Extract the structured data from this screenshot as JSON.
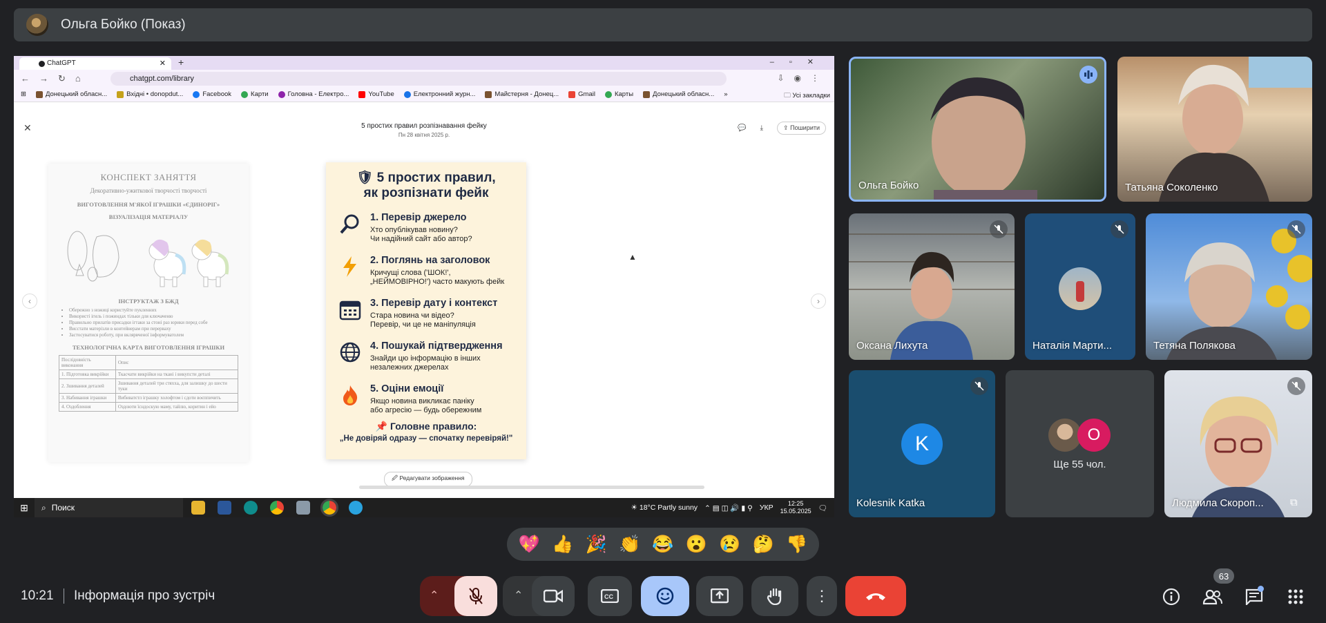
{
  "header": {
    "title": "Ольга Бойко (Показ)"
  },
  "browser": {
    "tab_title": "ChatGPT",
    "new_tab": "+",
    "url": "chatgpt.com/library",
    "bookmarks": [
      "Донецький обласн...",
      "Вхідні • donopdut...",
      "Facebook",
      "Карти",
      "Головна - Електро...",
      "YouTube",
      "Електронний журн...",
      "Майстерня - Донец...",
      "Gmail",
      "Карты",
      "Донецький обласн..."
    ],
    "bookmarks_more": "»",
    "all_bookmarks": "Усі закладки"
  },
  "page": {
    "title": "5 простих правил розпізнавання фейку",
    "date": "Пн 28 квітня 2025 р.",
    "share": "Поширити",
    "edit_image": "Редагувати зображення"
  },
  "left_doc": {
    "title": "КОНСПЕКТ ЗАНЯТТЯ",
    "subtitle": "Декоративно-ужиткової творчості творчості",
    "heading": "ВИГОТОВЛЕННЯ М'ЯКОЇ ІГРАШКИ «ЄДИНОРІГ»",
    "section_visual": "ВІЗУАЛІЗАЦІЯ МАТЕРІАЛУ",
    "section_safety": "ІНСТРУКТАЖ З БЖД",
    "safety_items": [
      "Обережно з ножиці користуйте пукленних",
      "Використі ігиль і пожиндах тільки для ключаченю",
      "Правильно прилатів присадки ігтаки за стоні раз юрики перед собе",
      "Висстати матерізли в контейнерам при перерваху",
      "Застосуватися роботу, при вклярвченої інформуватолем"
    ],
    "section_map": "ТЕХНОЛОГІЧНА КАРТА ВИГОТОВЛЕННЯ ІГРАШКИ",
    "table_headers": [
      "Послідовність виконання",
      "Опис"
    ],
    "table_rows": [
      [
        "1. Підготовка викрійки",
        "Ткасчати викрійки на ткані і викупсти деталі"
      ],
      [
        "2. Зшивання деталей",
        "Зшивання деталей три стяхха, для залишку до шести туки"
      ],
      [
        "3. Набивання іграшки",
        "Вибиватєтл іграшку холофтом і сдоти воєппичить"
      ],
      [
        "4. Оздоблення",
        "Оздоюти їсндоскую маму, тайлю, коритин і ейо"
      ]
    ]
  },
  "card": {
    "title_line1": "5 простих правил,",
    "title_line2": "як розпізнати фейк",
    "rules": [
      {
        "icon": "magnifier-icon",
        "title": "1. Перевір джерело",
        "line1": "Хто опублікував новину?",
        "line2": "Чи надійний сайт або автор?"
      },
      {
        "icon": "lightning-icon",
        "title": "2. Поглянь на заголовок",
        "line1": "Кричущі слова ('ШОК!',",
        "line2": "„НЕЙМОВІРНО!') часто макують фейк"
      },
      {
        "icon": "calendar-icon",
        "title": "3. Перевір дату і контекст",
        "line1": "Стара новина чи відео?",
        "line2": "Перевір, чи це не маніпуляція"
      },
      {
        "icon": "globe-icon",
        "title": "4. Пошукай підтвердження",
        "line1": "Знайди цю інформацію в інших",
        "line2": "незалежних джерелах"
      },
      {
        "icon": "fire-icon",
        "title": "5. Оціни емоції",
        "line1": "Якщо новина викликає паніку",
        "line2": "або агресію — будь обережним"
      }
    ],
    "main_rule": "Головне правило:",
    "main_quote": "„Не довіряй одразу — спочатку перевіряй!\""
  },
  "taskbar": {
    "search": "Поиск",
    "weather": "18°C  Partly sunny",
    "lang": "УКР",
    "time": "12:25",
    "date": "15.05.2025"
  },
  "participants": [
    {
      "name": "Ольга Бойко",
      "state": "speaking"
    },
    {
      "name": "Татьяна Соколенко",
      "state": "unmuted"
    },
    {
      "name": "Оксана Лихута",
      "state": "muted"
    },
    {
      "name": "Наталія Марти...",
      "state": "muted"
    },
    {
      "name": "Тетяна Полякова",
      "state": "muted"
    },
    {
      "name": "Kolesnik Katka",
      "state": "muted",
      "initial": "K"
    },
    {
      "name": "Людмила Скороп...",
      "state": "muted"
    }
  ],
  "more_tile": {
    "label": "Ще 55 чол.",
    "initial": "O"
  },
  "reactions": [
    "💖",
    "👍",
    "🎉",
    "👏",
    "😂",
    "😮",
    "😢",
    "🤔",
    "👎"
  ],
  "bottom": {
    "time": "10:21",
    "meeting_info": "Інформація про зустріч",
    "people_count": "63"
  },
  "colors": {
    "end_call": "#ea4335",
    "mic_off_bg": "#f9dedc",
    "active_btn": "#a8c7fa",
    "speaking_border": "#8ab4f8"
  }
}
